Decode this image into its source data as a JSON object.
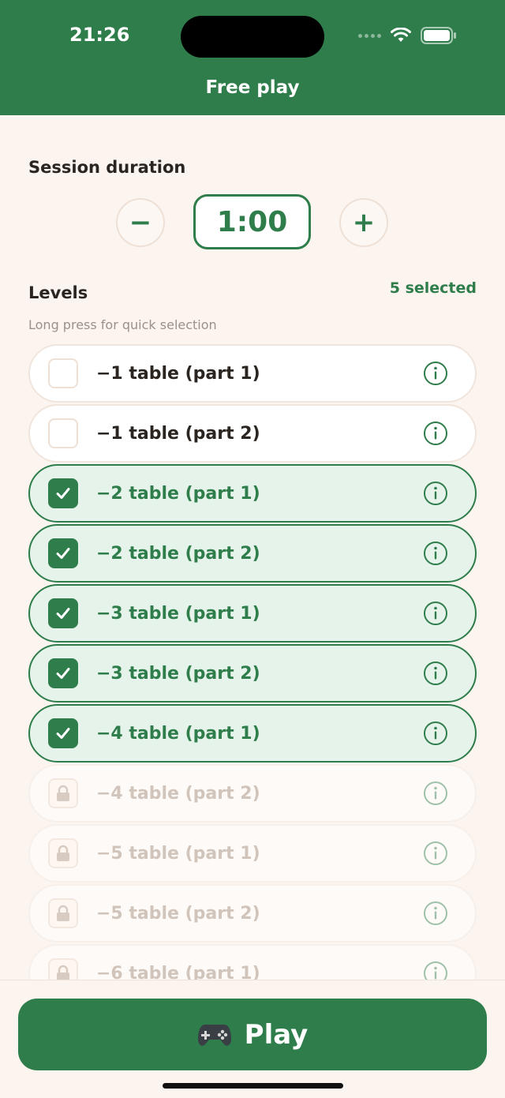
{
  "status": {
    "time": "21:26"
  },
  "header": {
    "title": "Free play"
  },
  "duration": {
    "title": "Session duration",
    "value": "1:00",
    "decrease_label": "−",
    "increase_label": "+"
  },
  "levels": {
    "title": "Levels",
    "selected_count": "5 selected",
    "hint": "Long press for quick selection",
    "items": [
      {
        "label": "−1 table (part 1)",
        "state": "unchecked"
      },
      {
        "label": "−1 table (part 2)",
        "state": "unchecked"
      },
      {
        "label": "−2 table (part 1)",
        "state": "checked"
      },
      {
        "label": "−2 table (part 2)",
        "state": "checked"
      },
      {
        "label": "−3 table (part 1)",
        "state": "checked"
      },
      {
        "label": "−3 table (part 2)",
        "state": "checked"
      },
      {
        "label": "−4 table (part 1)",
        "state": "checked"
      },
      {
        "label": "−4 table (part 2)",
        "state": "locked"
      },
      {
        "label": "−5 table (part 1)",
        "state": "locked"
      },
      {
        "label": "−5 table (part 2)",
        "state": "locked"
      },
      {
        "label": "−6 table (part 1)",
        "state": "locked"
      }
    ]
  },
  "play": {
    "label": "Play",
    "icon": "gamepad-icon"
  },
  "colors": {
    "accent": "#2e7d4b",
    "background": "#fcf4ef",
    "checked_bg": "#e5f3ea"
  }
}
